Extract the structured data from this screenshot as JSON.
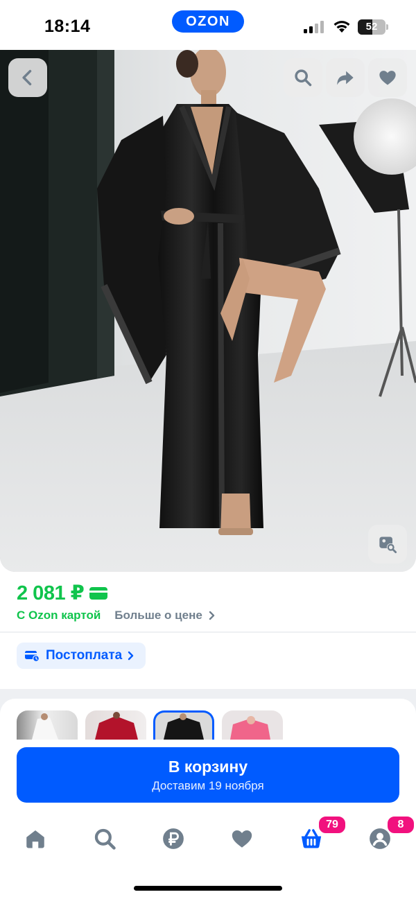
{
  "status_bar": {
    "time": "18:14",
    "app_badge": "OZON",
    "battery_percent": "52",
    "battery_level": 0.52
  },
  "photo": {
    "back_icon": "chevron-left-icon",
    "search_icon": "search-icon",
    "share_icon": "share-arrow-icon",
    "favorite_icon": "heart-icon",
    "similar_search_icon": "image-search-icon"
  },
  "price": {
    "value": "2 081 ₽",
    "card_label": "С Ozon картой",
    "more_label": "Больше о цене"
  },
  "postpay": {
    "label": "Постоплата"
  },
  "cart": {
    "title": "В корзину",
    "delivery": "Доставим 19 ноября"
  },
  "colors": {
    "accent": "#005bff",
    "price_green": "#10c44c",
    "badge_pink": "#f1117e"
  },
  "bottom_nav": {
    "items": [
      {
        "name": "home",
        "icon": "home-icon"
      },
      {
        "name": "search",
        "icon": "search-icon"
      },
      {
        "name": "finance",
        "icon": "ruble-icon"
      },
      {
        "name": "favorites",
        "icon": "heart-icon"
      },
      {
        "name": "cart",
        "icon": "basket-icon",
        "badge": "79"
      },
      {
        "name": "profile",
        "icon": "profile-icon",
        "badge": "8"
      }
    ]
  }
}
